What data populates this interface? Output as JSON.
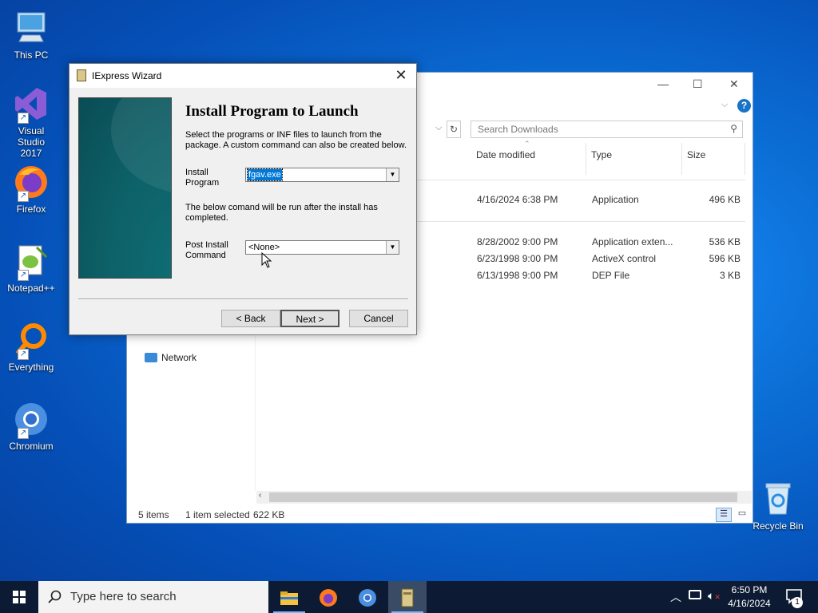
{
  "desktop": {
    "icons": [
      {
        "label": "This PC"
      },
      {
        "label": "Visual Studio 2017"
      },
      {
        "label": "Firefox"
      },
      {
        "label": "Notepad++"
      },
      {
        "label": "Everything"
      },
      {
        "label": "Chromium"
      },
      {
        "label": "Recycle Bin"
      }
    ]
  },
  "explorer": {
    "search_placeholder": "Search Downloads",
    "columns": [
      "Date modified",
      "Type",
      "Size"
    ],
    "files": [
      {
        "date": "4/16/2024 6:38 PM",
        "type": "Application",
        "size": "496 KB"
      },
      {
        "date": "8/28/2002 9:00 PM",
        "type": "Application exten...",
        "size": "536 KB"
      },
      {
        "date": "6/23/1998 9:00 PM",
        "type": "ActiveX control",
        "size": "596 KB"
      },
      {
        "date": "6/13/1998 9:00 PM",
        "type": "DEP File",
        "size": "3 KB"
      }
    ],
    "nav_network": "Network",
    "status": {
      "items": "5 items",
      "selected": "1 item selected",
      "size": "622 KB"
    }
  },
  "dialog": {
    "title": "IExpress Wizard",
    "heading": "Install Program to Launch",
    "description": "Select the programs or INF files to launch from the package.  A custom command can also be created below.",
    "install_label": "Install Program",
    "install_value": "fgav.exe",
    "after_text": "The below comand will be run after the install has completed.",
    "post_label": "Post Install Command",
    "post_value": "<None>",
    "buttons": {
      "back": "< Back",
      "next": "Next >",
      "cancel": "Cancel"
    }
  },
  "taskbar": {
    "search_placeholder": "Type here to search",
    "time": "6:50 PM",
    "date": "4/16/2024",
    "notification_count": "1"
  }
}
